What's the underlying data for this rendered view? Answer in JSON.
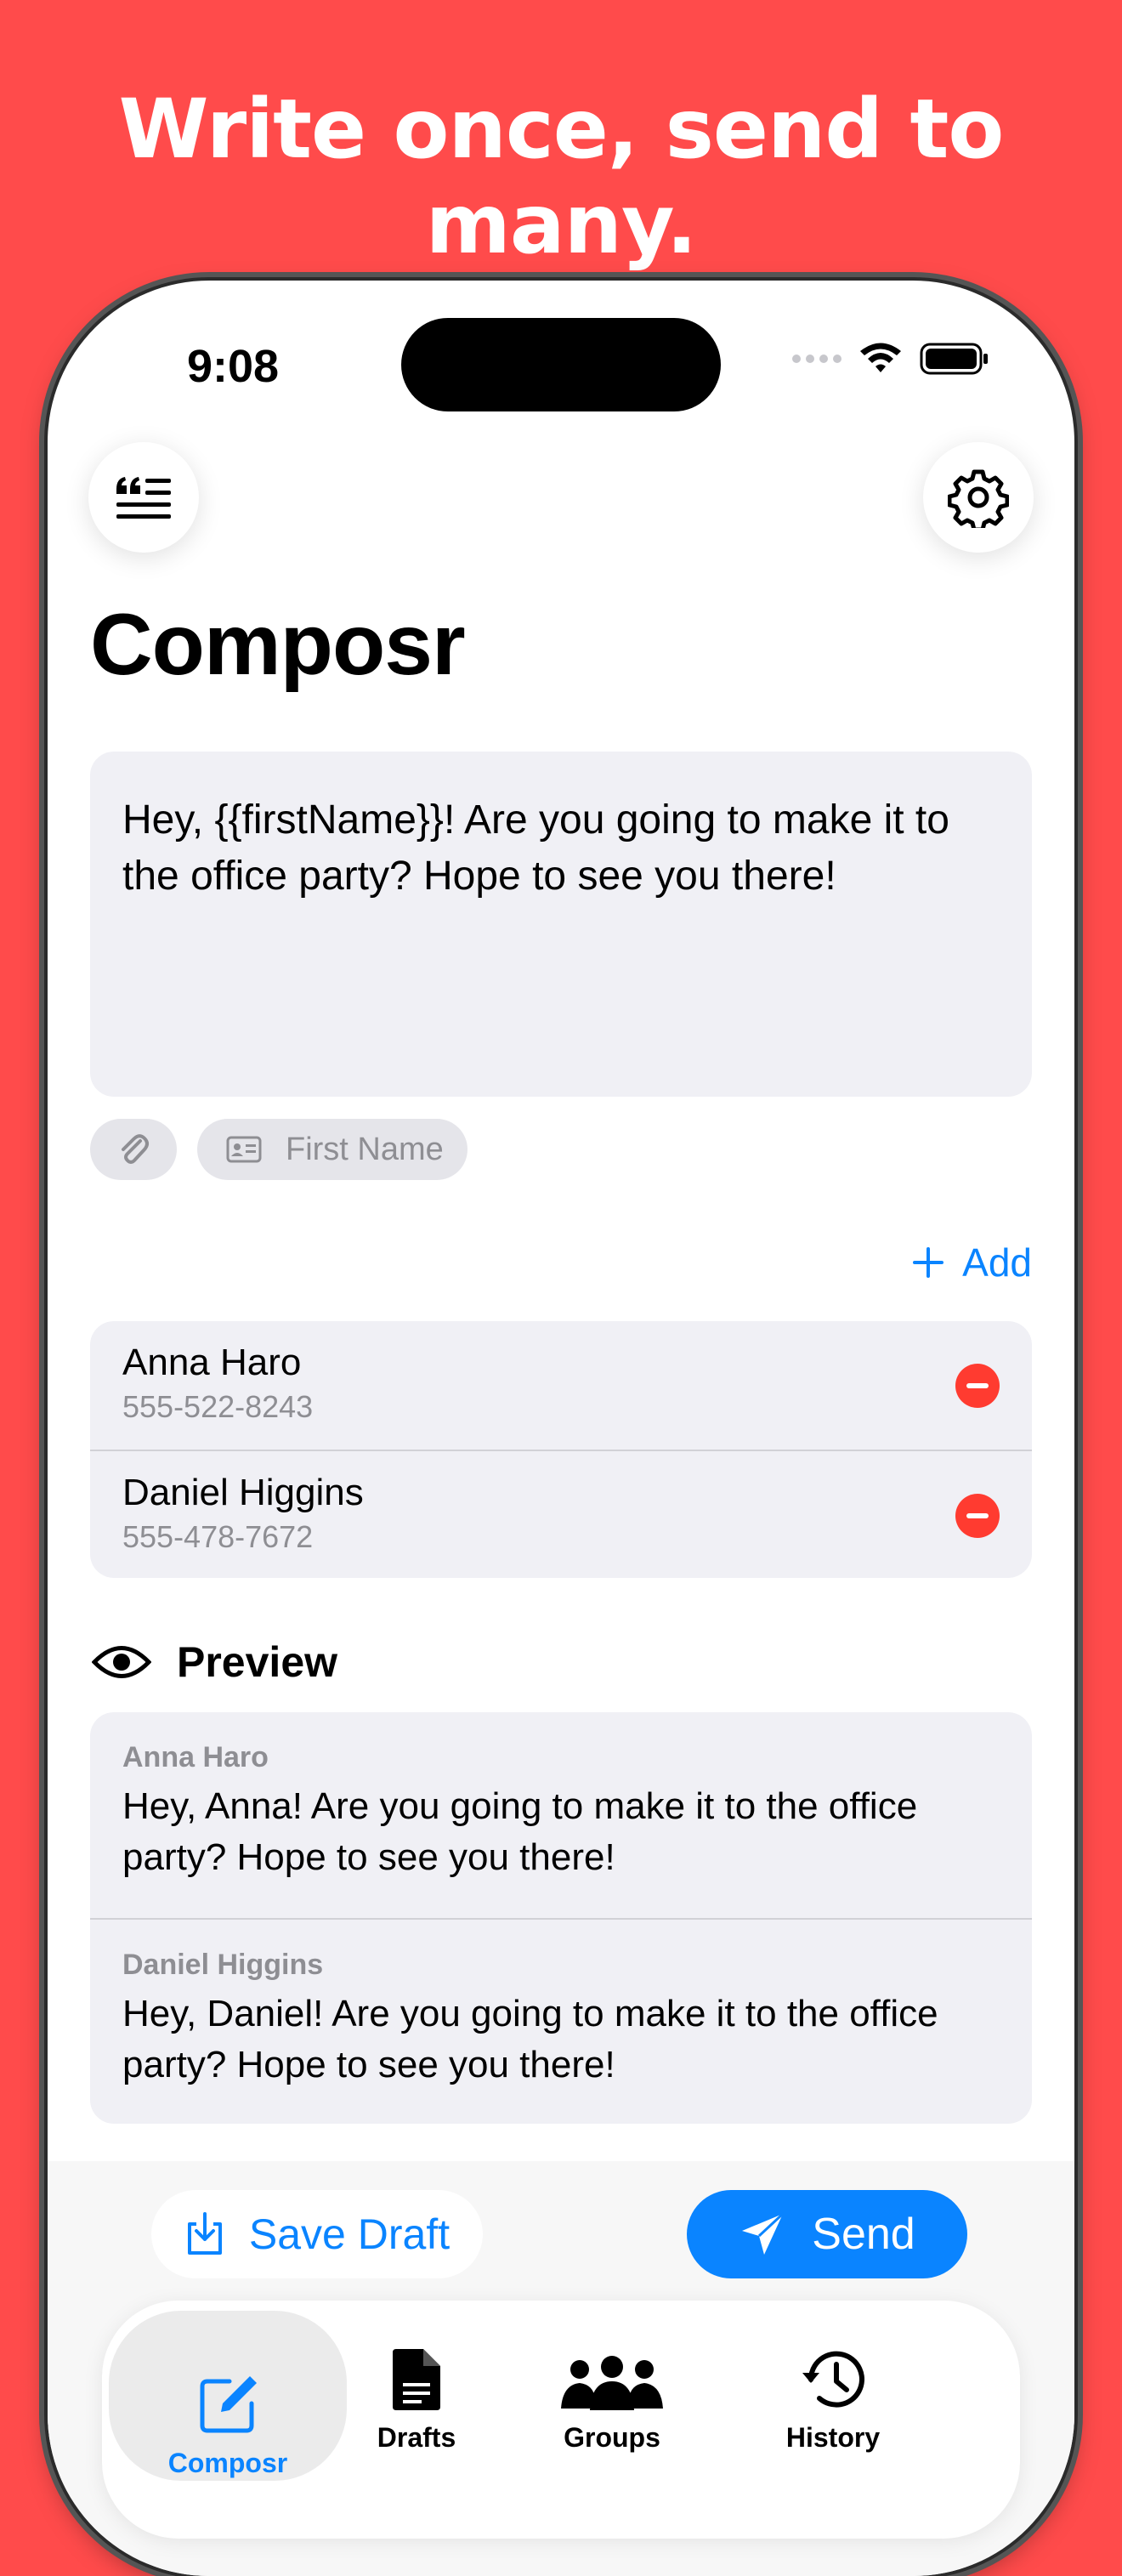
{
  "hero": {
    "headline": "Write once, send to many."
  },
  "status_bar": {
    "time": "9:08"
  },
  "header": {
    "title": "Composr",
    "left_icon": "quote-list-icon",
    "right_icon": "gear-icon"
  },
  "composer": {
    "message": "Hey, {{firstName}}! Are you going to make it to the office party? Hope to see you there!",
    "chips": {
      "attach_icon": "paperclip-icon",
      "first_name_label": "First Name"
    }
  },
  "recipients": {
    "add_label": "Add",
    "items": [
      {
        "name": "Anna Haro",
        "phone": "555-522-8243"
      },
      {
        "name": "Daniel Higgins",
        "phone": "555-478-7672"
      }
    ]
  },
  "preview": {
    "heading": "Preview",
    "items": [
      {
        "name": "Anna Haro",
        "text": "Hey, Anna! Are you going to make it to the office party? Hope to see you there!"
      },
      {
        "name": "Daniel Higgins",
        "text": "Hey, Daniel! Are you going to make it to the office party? Hope to see you there!"
      }
    ]
  },
  "actions": {
    "save_draft": "Save Draft",
    "send": "Send"
  },
  "tabs": [
    {
      "label": "Composr",
      "active": true
    },
    {
      "label": "Drafts",
      "active": false
    },
    {
      "label": "Groups",
      "active": false
    },
    {
      "label": "History",
      "active": false
    }
  ],
  "colors": {
    "background": "#FF4B4B",
    "accent": "#0A84FF",
    "destructive": "#FF3B30",
    "card": "#F0F0F5"
  }
}
